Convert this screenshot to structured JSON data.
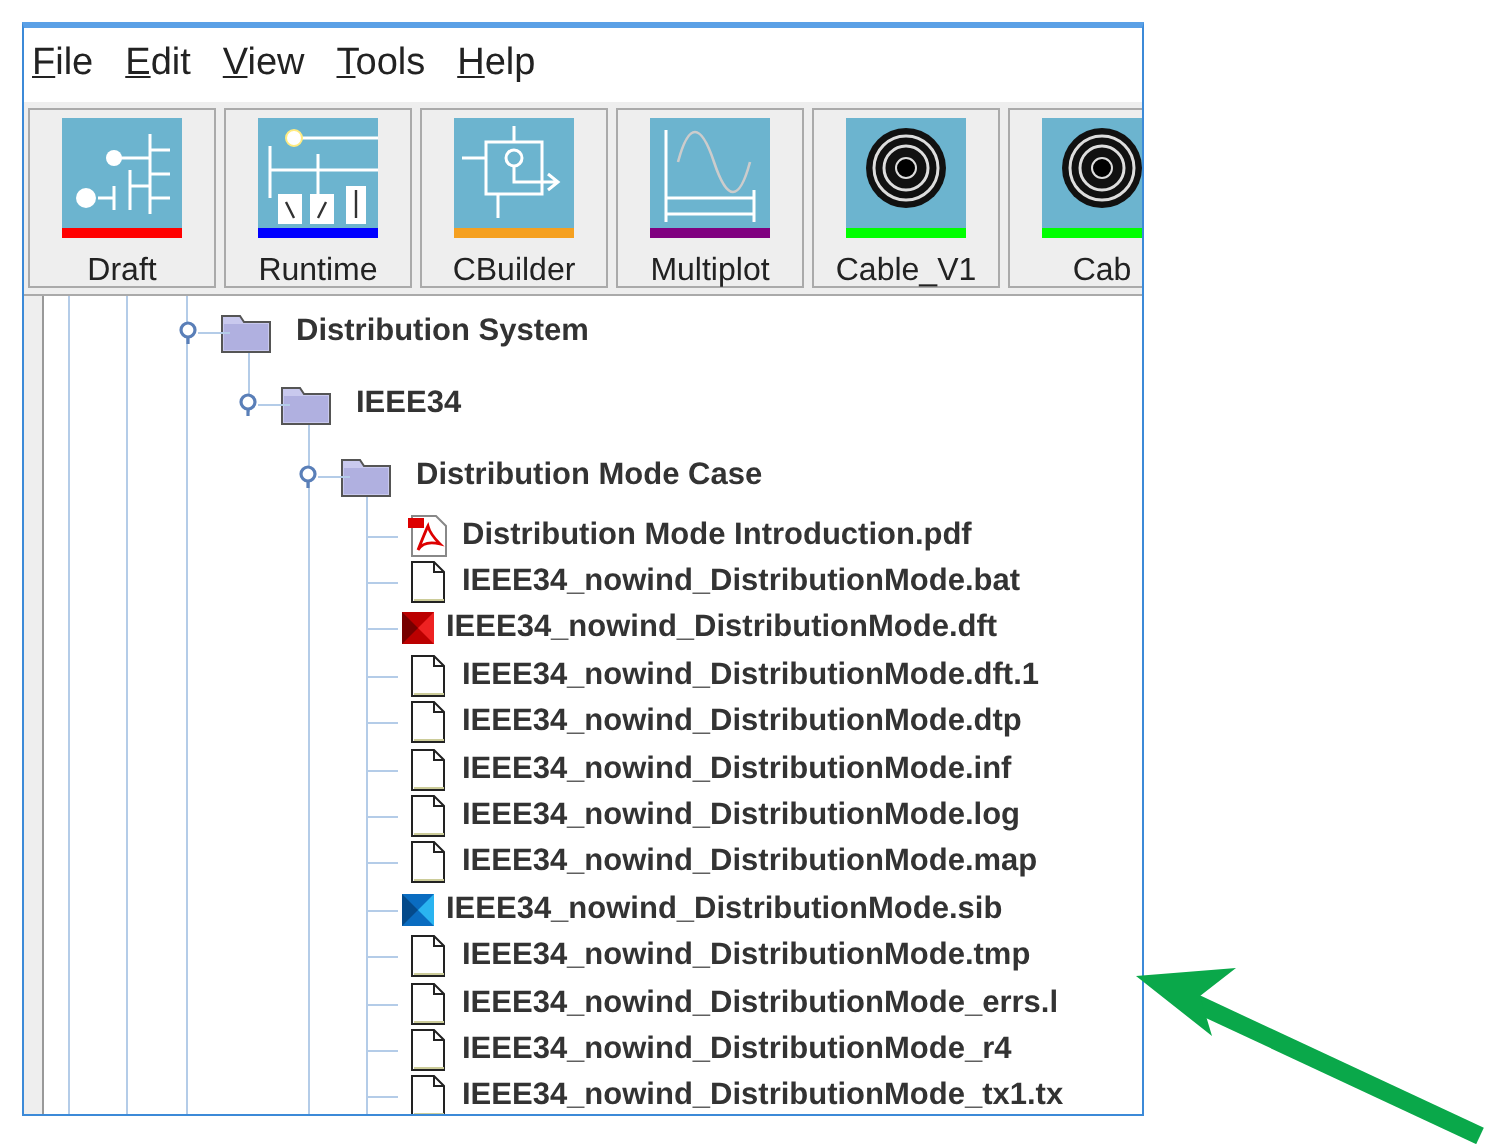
{
  "menu": [
    {
      "label": "File"
    },
    {
      "label": "Edit"
    },
    {
      "label": "View"
    },
    {
      "label": "Tools"
    },
    {
      "label": "Help"
    }
  ],
  "toolbar": [
    {
      "label": "Draft",
      "kind": "draft",
      "color": "#ff0000"
    },
    {
      "label": "Runtime",
      "kind": "runtime",
      "color": "#0000ff"
    },
    {
      "label": "CBuilder",
      "kind": "cbuilder",
      "color": "#f5a020"
    },
    {
      "label": "Multiplot",
      "kind": "multiplot",
      "color": "#800080"
    },
    {
      "label": "Cable_V1",
      "kind": "cable",
      "color": "#00ff00"
    },
    {
      "label": "Cab",
      "kind": "cable",
      "color": "#00ff00"
    }
  ],
  "tree": [
    {
      "label": "Distribution System",
      "kind": "folder",
      "expanded": true,
      "children": [
        {
          "label": "IEEE34",
          "kind": "folder",
          "expanded": true,
          "children": [
            {
              "label": "Distribution Mode Case",
              "kind": "folder",
              "expanded": true,
              "children": [
                {
                  "label": "Distribution Mode Introduction.pdf",
                  "kind": "pdf"
                },
                {
                  "label": "IEEE34_nowind_DistributionMode.bat",
                  "kind": "document"
                },
                {
                  "label": "IEEE34_nowind_DistributionMode.dft",
                  "kind": "red-model"
                },
                {
                  "label": "IEEE34_nowind_DistributionMode.dft.1",
                  "kind": "document"
                },
                {
                  "label": "IEEE34_nowind_DistributionMode.dtp",
                  "kind": "document"
                },
                {
                  "label": "IEEE34_nowind_DistributionMode.inf",
                  "kind": "document"
                },
                {
                  "label": "IEEE34_nowind_DistributionMode.log",
                  "kind": "document"
                },
                {
                  "label": "IEEE34_nowind_DistributionMode.map",
                  "kind": "document"
                },
                {
                  "label": "IEEE34_nowind_DistributionMode.sib",
                  "kind": "blue-model"
                },
                {
                  "label": "IEEE34_nowind_DistributionMode.tmp",
                  "kind": "document"
                },
                {
                  "label": "IEEE34_nowind_DistributionMode_errs.l",
                  "kind": "document"
                },
                {
                  "label": "IEEE34_nowind_DistributionMode_r4",
                  "kind": "document"
                },
                {
                  "label": "IEEE34_nowind_DistributionMode_tx1.tx",
                  "kind": "document"
                }
              ]
            }
          ]
        }
      ]
    }
  ]
}
